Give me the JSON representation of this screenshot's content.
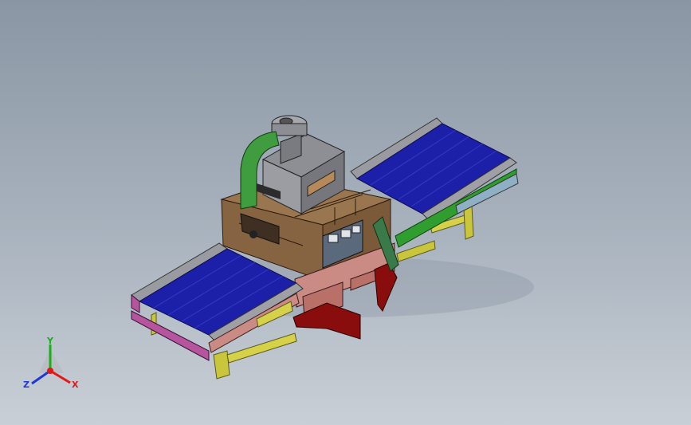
{
  "viewport": {
    "background": "#9aa5b1",
    "model": "uv-curing-conveyor-machine"
  },
  "colors": {
    "belt": "#1c20a8",
    "frame": "#8f9095",
    "housing": "#8b6a45",
    "lamp_box": "#8a8b90",
    "duct": "#3f9c3f",
    "stand": "#c6c43a",
    "skirt": "#b4559e",
    "guard": "#b88378",
    "flap": "#8a0d0d",
    "rail_green": "#2f9e2f"
  },
  "triad": {
    "x_label": "X",
    "y_label": "Y",
    "z_label": "Z",
    "x_color": "#e01818",
    "y_color": "#18b018",
    "z_color": "#1c38d8"
  }
}
